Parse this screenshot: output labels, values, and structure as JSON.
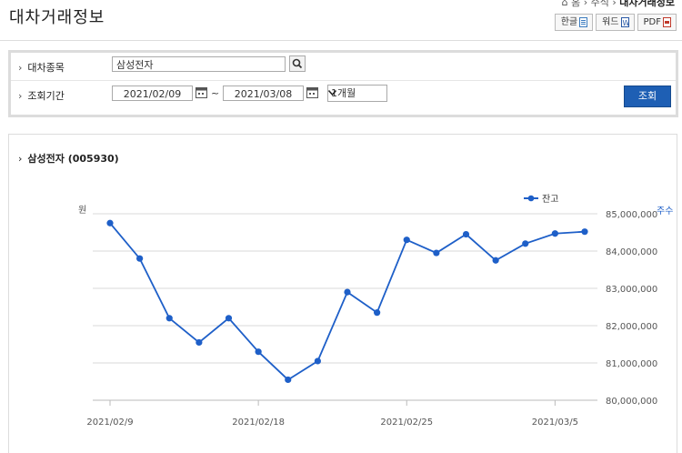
{
  "page": {
    "title": "대차거래정보",
    "breadcrumb": [
      "홈",
      "주식",
      "대차거래정보"
    ],
    "downloads": [
      "한글",
      "워드",
      "PDF"
    ]
  },
  "search": {
    "stock_label": "대차종목",
    "stock_value": "삼성전자",
    "period_label": "조회기간",
    "date_from": "2021/02/09",
    "tilde": "~",
    "date_to": "2021/03/08",
    "range_select": "1개월",
    "submit_label": "조회"
  },
  "chart_section": {
    "title": "삼성전자 (005930)"
  },
  "chart_data": {
    "type": "line",
    "series": [
      {
        "name": "잔고",
        "color": "#1e5fc8",
        "values": [
          84750000,
          83800000,
          82200000,
          81550000,
          82200000,
          81300000,
          80550000,
          81050000,
          82900000,
          82350000,
          84300000,
          83950000,
          84450000,
          83750000,
          84200000,
          84470000,
          84520000
        ]
      }
    ],
    "xticks": [
      "2021/02/9",
      "2021/02/18",
      "2021/02/25",
      "2021/03/5"
    ],
    "xtick_index": [
      0,
      5,
      10,
      15
    ],
    "ylim": [
      80000000,
      85000000
    ],
    "yticks": [
      "85,000,000",
      "84,000,000",
      "83,000,000",
      "82,000,000",
      "81,000,000",
      "80,000,000"
    ],
    "ytick_values": [
      85000000,
      84000000,
      83000000,
      82000000,
      81000000,
      80000000
    ],
    "left_unit": "원",
    "right_unit": "주수",
    "grid": true,
    "legend": "top-right"
  }
}
